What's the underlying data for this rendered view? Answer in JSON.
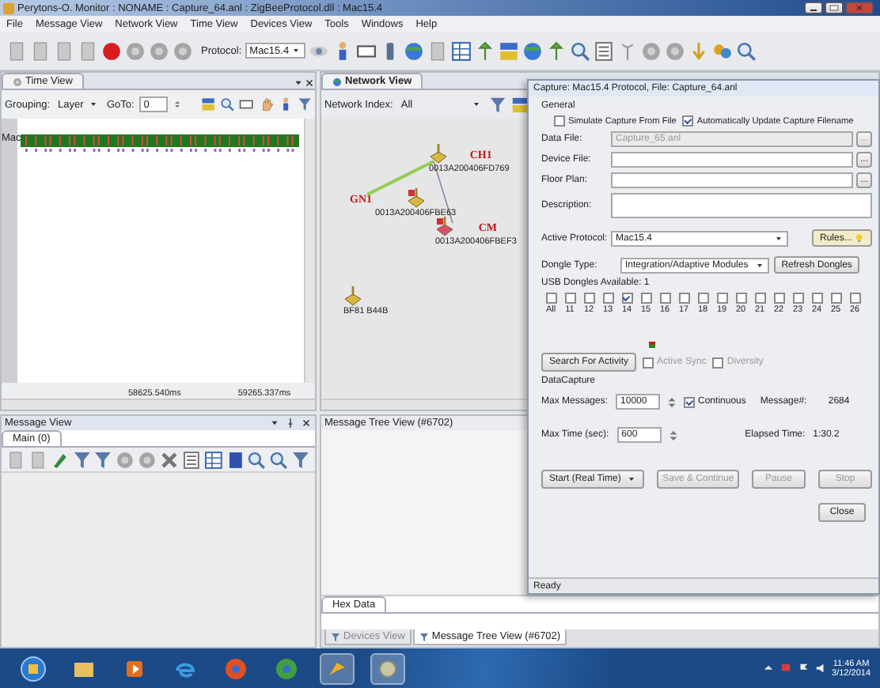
{
  "window": {
    "title": "Perytons-O. Monitor : NONAME : Capture_64.anl : ZigBeeProtocol.dll : Mac15.4"
  },
  "menu": [
    "File",
    "Message View",
    "Network View",
    "Time View",
    "Devices View",
    "Tools",
    "Windows",
    "Help"
  ],
  "toolbar": {
    "protocol_label": "Protocol:",
    "protocol_value": "Mac15.4"
  },
  "time_view": {
    "tab": "Time View",
    "grouping_label": "Grouping:",
    "grouping_value": "Layer",
    "goto_label": "GoTo:",
    "goto_value": "0",
    "row_label": "Mac",
    "ticks": [
      "58625.540ms",
      "59265.337ms"
    ]
  },
  "network_view": {
    "tab": "Network View",
    "index_label": "Network Index:",
    "index_value": "All",
    "nodes": [
      {
        "role": "CH1",
        "address": "0013A200406FD769",
        "color": "#d8b640",
        "flagged": false
      },
      {
        "role": "GN1",
        "address": "0013A200406FBE63",
        "color": "#d8b640",
        "flagged": true
      },
      {
        "role": "CM",
        "address": "0013A200406FBEF3",
        "color": "#d8506c",
        "flagged": true
      },
      {
        "address": "BF81 B44B",
        "color": "#d8b640",
        "flagged": false
      }
    ],
    "links": [
      {
        "color": "#8fd14f"
      },
      {
        "color": "#9a80a8"
      }
    ]
  },
  "message_view": {
    "title": "Message View",
    "tab": "Main (0)"
  },
  "message_tree_view": {
    "title": "Message Tree View (#6702)",
    "hex_tab": "Hex Data",
    "bottom_tabs": [
      {
        "label": "Devices View",
        "selected": false
      },
      {
        "label": "Message Tree View (#6702)",
        "selected": true
      }
    ]
  },
  "capture_dialog": {
    "title": "Capture: Mac15.4 Protocol, File: Capture_64.anl",
    "general_heading": "General",
    "options": [
      {
        "label": "Simulate Capture From File",
        "checked": false
      },
      {
        "label": "Automatically Update Capture Filename",
        "checked": true
      }
    ],
    "files": [
      {
        "kind": "file",
        "label": "Data File:",
        "value": "Capture_65.anl",
        "disabled": true,
        "browse": "..."
      },
      {
        "kind": "file",
        "label": "Device File:",
        "disabled": false,
        "browse": "..."
      },
      {
        "kind": "file",
        "label": "Floor Plan:",
        "disabled": false,
        "browse": "..."
      },
      {
        "kind": "memo",
        "label": "Description:",
        "disabled": false
      }
    ],
    "active_protocol": {
      "label": "Active Protocol:",
      "value": "Mac15.4"
    },
    "rules_button": "Rules...",
    "dongle_type": {
      "label": "Dongle Type:",
      "value": "Integration/Adaptive Modules"
    },
    "refresh_button": "Refresh Dongles",
    "dongles_available": "USB Dongles Available:  1",
    "channels": [
      {
        "label": "All",
        "checked": false
      },
      {
        "label": "11",
        "checked": false
      },
      {
        "label": "12",
        "checked": false
      },
      {
        "label": "13",
        "checked": false
      },
      {
        "label": "14",
        "checked": true
      },
      {
        "label": "15",
        "checked": false
      },
      {
        "label": "16",
        "checked": false
      },
      {
        "label": "17",
        "checked": false
      },
      {
        "label": "18",
        "checked": false
      },
      {
        "label": "19",
        "checked": false
      },
      {
        "label": "20",
        "checked": false
      },
      {
        "label": "21",
        "checked": false
      },
      {
        "label": "22",
        "checked": false
      },
      {
        "label": "23",
        "checked": false
      },
      {
        "label": "24",
        "checked": false
      },
      {
        "label": "25",
        "checked": false
      },
      {
        "label": "26",
        "checked": false
      }
    ],
    "search_button": "Search For Activity",
    "sync_options": [
      {
        "label": "Active Sync",
        "checked": false,
        "disabled": true
      },
      {
        "label": "Diversity",
        "checked": false,
        "disabled": true
      }
    ],
    "capture_heading": "DataCapture",
    "max_messages": {
      "label": "Max Messages:",
      "value": "10000"
    },
    "continuous": {
      "label": "Continuous",
      "checked": true
    },
    "message_count": {
      "label": "Message#:",
      "value": "2684"
    },
    "max_time": {
      "label": "Max Time (sec):",
      "value": "600"
    },
    "elapsed": {
      "label": "Elapsed Time:",
      "value": "1:30.2"
    },
    "actions": [
      {
        "kind": "dropdown",
        "label": "Start (Real Time)",
        "disabled": false
      },
      {
        "kind": "button",
        "label": "Save & Continue",
        "disabled": true
      },
      {
        "kind": "button",
        "label": "Pause",
        "disabled": true
      },
      {
        "kind": "button",
        "label": "Stop",
        "disabled": true
      }
    ],
    "close_button": "Close",
    "status": "Ready"
  },
  "taskbar": {
    "time": "11:46 AM",
    "date": "3/12/2014"
  }
}
